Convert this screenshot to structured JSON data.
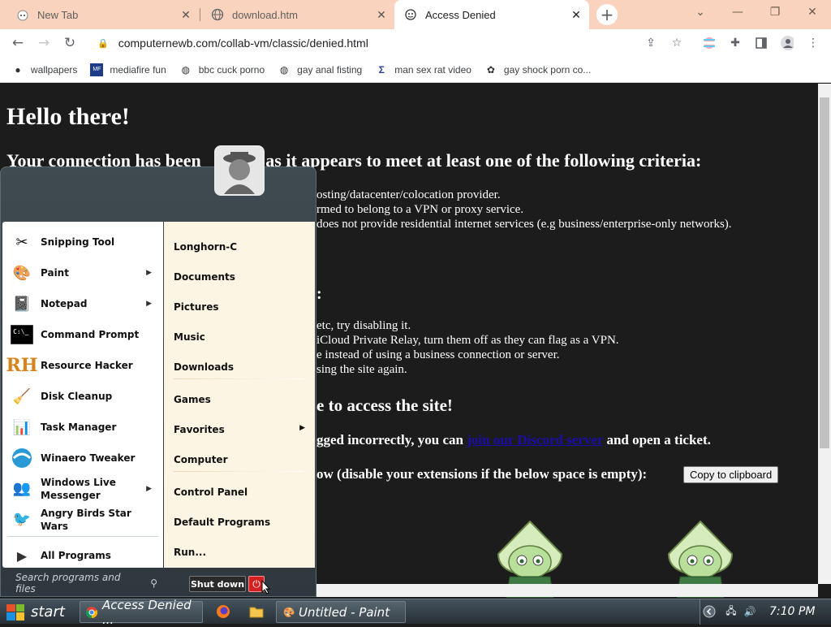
{
  "browser": {
    "tabs": [
      {
        "title": "New Tab",
        "active": false
      },
      {
        "title": "download.htm",
        "active": false
      },
      {
        "title": "Access Denied",
        "active": true
      }
    ],
    "url": "computernewb.com/collab-vm/classic/denied.html",
    "bookmarks": [
      {
        "label": "wallpapers",
        "icon": "reddit-icon"
      },
      {
        "label": "mediafire fun",
        "icon": "mediafire-icon"
      },
      {
        "label": "bbc cuck porno",
        "icon": "globe-icon"
      },
      {
        "label": "gay anal fisting",
        "icon": "globe-icon"
      },
      {
        "label": "man sex rat video",
        "icon": "sigma-icon"
      },
      {
        "label": "gay shock porn co...",
        "icon": "puzzle-icon"
      }
    ]
  },
  "page": {
    "heading": "Hello there!",
    "subheading": "Your connection has been blocked as it appears to meet at least one of the following criteria:",
    "sub_left": "Your connection has been",
    "sub_right": "ed as it appears to meet at least one of the following criteria:",
    "criteria": [
      "osting/datacenter/colocation provider.",
      "rmed to belong to a VPN or proxy service.",
      " does not provide residential internet services (e.g business/enterprise-only networks)."
    ],
    "colon": ":",
    "tips": [
      "etc, try disabling it.",
      " iCloud Private Relay, turn them off as they can flag as a VPN.",
      "e instead of using a business connection or server.",
      "sing the site again."
    ],
    "access_line": "e to access the site!",
    "ticket_prefix": "gged incorrectly, you can ",
    "ticket_link": "join our Discord server",
    "ticket_suffix": " and open a ticket.",
    "below_line": "ow (disable your extensions if the below space is empty):",
    "copy_button": "Copy to clipboard"
  },
  "start_menu": {
    "left_items": [
      {
        "label": "Snipping Tool",
        "icon": "scissors-icon",
        "submenu": false
      },
      {
        "label": "Paint",
        "icon": "paint-icon",
        "submenu": true
      },
      {
        "label": "Notepad",
        "icon": "notepad-icon",
        "submenu": true
      },
      {
        "label": "Command Prompt",
        "icon": "cmd-icon",
        "submenu": false
      },
      {
        "label": "Resource Hacker",
        "icon": "rh-icon",
        "submenu": false
      },
      {
        "label": "Disk Cleanup",
        "icon": "disk-icon",
        "submenu": false
      },
      {
        "label": "Task Manager",
        "icon": "taskmgr-icon",
        "submenu": false
      },
      {
        "label": "Winaero Tweaker",
        "icon": "winaero-icon",
        "submenu": false
      },
      {
        "label": "Windows Live Messenger",
        "icon": "messenger-icon",
        "submenu": true
      },
      {
        "label": "Angry Birds Star Wars",
        "icon": "angrybirds-icon",
        "submenu": false
      }
    ],
    "all_programs": "All Programs",
    "right_items": [
      {
        "label": "Longhorn-C"
      },
      {
        "label": "Documents"
      },
      {
        "label": "Pictures"
      },
      {
        "label": "Music"
      },
      {
        "label": "Downloads"
      },
      {
        "label": "Games"
      },
      {
        "label": "Favorites"
      },
      {
        "label": "Computer"
      },
      {
        "label": "Control Panel"
      },
      {
        "label": "Default Programs"
      },
      {
        "label": "Run..."
      }
    ],
    "search_placeholder": "Search programs and files",
    "shutdown": "Shut down"
  },
  "taskbar": {
    "start": "start",
    "items": [
      {
        "label": "Access Denied ...",
        "icon": "chrome-icon"
      },
      {
        "label": "Untitled - Paint",
        "icon": "paint-icon"
      }
    ],
    "clock": "7:10 PM"
  }
}
